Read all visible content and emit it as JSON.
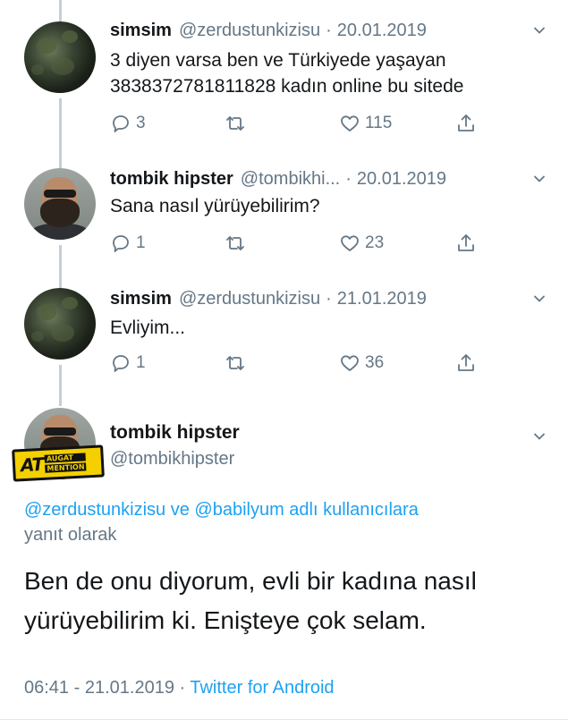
{
  "thread": [
    {
      "name": "simsim",
      "handle": "@zerdustunkizisu",
      "sep": "·",
      "date": "20.01.2019",
      "text": "3 diyen varsa ben ve Türkiyede yaşayan\n3838372781811828 kadın online bu sitede",
      "replies": "3",
      "retweets": "",
      "likes": "115",
      "avatar": "forest-avatar"
    },
    {
      "name": "tombik hipster",
      "handle": "@tombikhi...",
      "sep": "·",
      "date": "20.01.2019",
      "text": "Sana nasıl yürüyebilirim?",
      "replies": "1",
      "retweets": "",
      "likes": "23",
      "avatar": "bearded-man-avatar"
    },
    {
      "name": "simsim",
      "handle": "@zerdustunkizisu",
      "sep": "·",
      "date": "21.01.2019",
      "text": "Evliyim...",
      "replies": "1",
      "retweets": "",
      "likes": "36",
      "avatar": "forest-avatar"
    }
  ],
  "main_tweet": {
    "name": "tombik hipster",
    "handle": "@tombikhipster",
    "badge_main": "AT",
    "badge_sub_top": "AUGAT",
    "badge_sub_bottom": "MENTION",
    "mention_1": "@zerdustunkizisu",
    "joiner": " ve ",
    "mention_2": "@babilyum",
    "reply_suffix": " adlı kullanıcılara",
    "reply_line2": "yanıt olarak",
    "text": "Ben de onu diyorum, evli bir kadına nasıl\nyürüyebilirim ki. Enişteye çok selam.",
    "time": "06:41",
    "date_sep": " - ",
    "date": "21.01.2019",
    "source_sep": " · ",
    "source": "Twitter for Android"
  },
  "colors": {
    "text": "#14171a",
    "muted": "#657786",
    "link": "#1da1f2",
    "thread_line": "#c4cfd6",
    "badge": "#f4d000"
  },
  "icons": [
    "reply-icon",
    "retweet-icon",
    "like-icon",
    "share-icon",
    "chevron-down-icon"
  ]
}
